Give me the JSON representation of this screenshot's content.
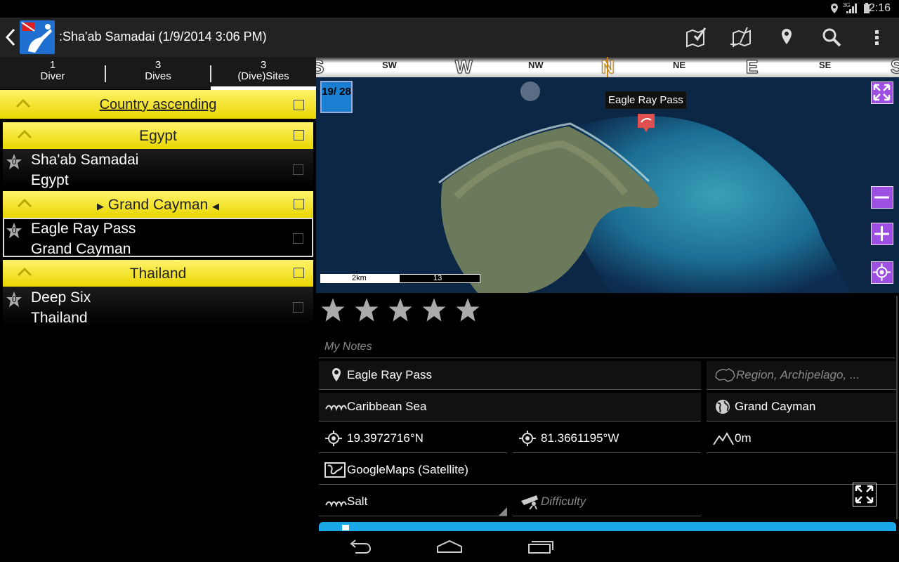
{
  "status_bar": {
    "time": "2:16",
    "network": "3G"
  },
  "action_bar": {
    "title": ":Sha'ab Samadai (1/9/2014 3:06 PM)",
    "actions": [
      "map-check-icon",
      "add-site-icon",
      "location-pin-icon",
      "search-icon",
      "overflow-menu-icon"
    ]
  },
  "tabs": [
    {
      "count": "1",
      "label": "Diver"
    },
    {
      "count": "3",
      "label": "Dives"
    },
    {
      "count": "3",
      "label": "(Dive)Sites"
    }
  ],
  "list": {
    "sort_header": "Country ascending",
    "groups": [
      {
        "label": "Egypt",
        "items": [
          {
            "title": "Sha'ab Samadai",
            "subtitle": "Egypt",
            "rating": "0"
          }
        ]
      },
      {
        "label": "Grand Cayman",
        "items": [
          {
            "title": "Eagle Ray Pass",
            "subtitle": "Grand Cayman",
            "rating": "0"
          }
        ]
      },
      {
        "label": "Thailand",
        "items": [
          {
            "title": "Deep Six",
            "subtitle": "Thailand",
            "rating": "0"
          }
        ]
      }
    ],
    "colors": {
      "group_bg": "#fff36a",
      "group_text": "#222222"
    }
  },
  "compass": {
    "directions": [
      "S",
      "SW",
      "W",
      "NW",
      "N",
      "NE",
      "E",
      "SE",
      "S"
    ]
  },
  "map": {
    "marker_label": "Eagle Ray Pass",
    "badge": "19/ 28",
    "scale_left": "2km",
    "scale_right": "13",
    "accent": "#9c4fe0"
  },
  "details": {
    "rating_stars": 5,
    "notes_placeholder": "My Notes",
    "site_name": "Eagle Ray Pass",
    "region_placeholder": "Region, Archipelago, ...",
    "water_body": "Caribbean Sea",
    "country": "Grand Cayman",
    "latitude": "19.3972716°N",
    "longitude": "81.3661195°W",
    "altitude": "0m",
    "map_type": "GoogleMaps (Satellite)",
    "water_type": "Salt",
    "difficulty_placeholder": "Difficulty",
    "accent": "#1aa8e8"
  },
  "navbar": [
    "back-icon",
    "home-icon",
    "recent-apps-icon"
  ]
}
